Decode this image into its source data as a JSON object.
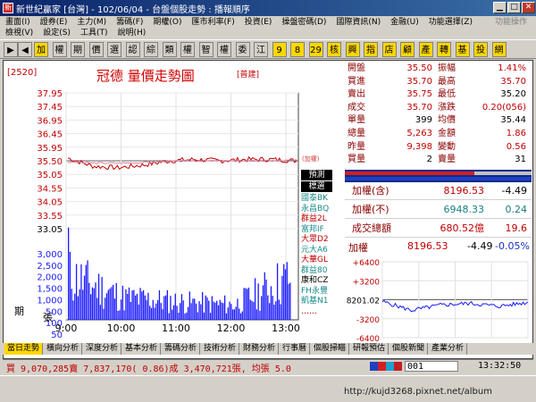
{
  "window": {
    "title": "新世紀贏家 [台灣] - 102/06/04 - 台盤個股走勢 : 播報順序",
    "icon": "app-icon"
  },
  "menu1": {
    "items": [
      "畫面(I)",
      "證券(E)",
      "主力(M)",
      "籌碼(F)",
      "期權(O)",
      "匯市利率(F)",
      "投資(E)",
      "操盤密碼(D)",
      "國際資訊(N)",
      "金融(U)",
      "功能選擇(Z)"
    ],
    "right": "功能操作"
  },
  "menu2": {
    "items": [
      "檢視(V)",
      "設定(S)",
      "工具(T)",
      "說明(H)"
    ]
  },
  "toolbar": {
    "buttons": [
      "加",
      "權",
      "期",
      "價",
      "選",
      "認",
      "綜",
      "類",
      "權",
      "智",
      "權",
      "委",
      "江",
      "9",
      "8",
      "29",
      "核",
      "興",
      "指",
      "店",
      "顧",
      "產",
      "轉",
      "基",
      "投",
      "網"
    ]
  },
  "chart": {
    "stock_code": "[2520]",
    "title": "冠德  量價走勢圖",
    "tag": "[普建]",
    "price_ticks": [
      "37.95",
      "37.45",
      "36.95",
      "36.45",
      "35.95",
      "35.50",
      "35.05",
      "34.55",
      "34.05",
      "33.55",
      "33.05"
    ],
    "volume_ticks": [
      "3,000",
      "2,500",
      "2,000",
      "1,500",
      "1,000",
      "500",
      "100",
      "50",
      "15"
    ],
    "volume_label": "張",
    "period_label": "期",
    "time_ticks": [
      "9:00",
      "10:00",
      "11:00",
      "12:00",
      "13:00"
    ],
    "avg_tag": "(加權)",
    "predict_btn": "預測",
    "bench_btn": "標選",
    "brokers": [
      {
        "name": "國泰BK",
        "color": "#1b8a8a"
      },
      {
        "name": "永昌BQ",
        "color": "#1b8a8a"
      },
      {
        "name": "群益2L",
        "color": "#c00000"
      },
      {
        "name": "富邦IF",
        "color": "#1b8a8a"
      },
      {
        "name": "大眾D2",
        "color": "#c00000"
      },
      {
        "name": "元大A6",
        "color": "#1b8a8a"
      },
      {
        "name": "大華GL",
        "color": "#c00000"
      },
      {
        "name": "群益80",
        "color": "#1b8a8a"
      },
      {
        "name": "康和CZ",
        "color": "#000000"
      },
      {
        "name": "FH永豐",
        "color": "#1b8a8a"
      },
      {
        "name": "凱基N1",
        "color": "#1b8a8a"
      },
      {
        "name": "……",
        "color": "#c00000"
      }
    ]
  },
  "chart_data": [
    {
      "type": "line",
      "title": "冠德 量價走勢圖",
      "ylim": [
        33.05,
        37.95
      ],
      "x": [
        "9:00",
        "9:30",
        "10:00",
        "10:30",
        "11:00",
        "11:30",
        "12:00",
        "12:30",
        "13:00",
        "13:30"
      ],
      "series": [
        {
          "name": "",
          "values": [
            35.6,
            35.3,
            35.25,
            35.35,
            35.5,
            35.55,
            35.5,
            35.55,
            35.55,
            35.5
          ]
        },
        {
          "name": "(加權)",
          "values": [
            35.45,
            35.42,
            35.42,
            35.44,
            35.48,
            35.5,
            35.5,
            35.5,
            35.5,
            35.52
          ]
        }
      ]
    },
    {
      "type": "bar",
      "ylim": [
        0,
        3000
      ],
      "categories": [
        "9:00",
        "10:00",
        "11:00",
        "12:00",
        "13:00"
      ],
      "values": [
        1500,
        750,
        600,
        500,
        1450
      ]
    },
    {
      "type": "line",
      "title": "加權",
      "ylim": [
        -6400,
        6400
      ],
      "x": [
        "9:00",
        "10:00",
        "11:00",
        "12:00",
        "13:00",
        "13:30"
      ],
      "series": [
        {
          "name": "",
          "values": [
            -300,
            -1800,
            -900,
            -600,
            -1100,
            -450
          ]
        }
      ]
    }
  ],
  "quote": {
    "rows": [
      {
        "l1": "開盤",
        "v1": "35.50",
        "c1": "#c00000",
        "l2": "振幅",
        "v2": "1.41%",
        "c2": "#c00000"
      },
      {
        "l1": "買進",
        "v1": "35.70",
        "c1": "#c00000",
        "l2": "最高",
        "v2": "35.70",
        "c2": "#c00000"
      },
      {
        "l1": "賣出",
        "v1": "35.75",
        "c1": "#c00000",
        "l2": "最低",
        "v2": "35.20",
        "c2": "#000000"
      },
      {
        "l1": "成交",
        "v1": "35.70",
        "c1": "#c00000",
        "l2": "漲跌",
        "v2": "0.20(056)",
        "c2": "#c00000"
      },
      {
        "l1": "單量",
        "v1": "399",
        "c1": "#000000",
        "l2": "均價",
        "v2": "35.44",
        "c2": "#000000"
      },
      {
        "l1": "總量",
        "v1": "5,263",
        "c1": "#c00000",
        "l2": "金額",
        "v2": "1.86",
        "c2": "#c00000"
      },
      {
        "l1": "昨量",
        "v1": "9,398",
        "c1": "#c00000",
        "l2": "變動",
        "v2": "0.56",
        "c2": "#c00000"
      },
      {
        "l1": "買量",
        "v1": "2",
        "c1": "#000000",
        "l2": "賣量",
        "v2": "31",
        "c2": "#000000"
      }
    ]
  },
  "index": {
    "rows": [
      {
        "label": "加權(含)",
        "value": "8196.53",
        "change": "-4.49",
        "vcolor": "#c00000",
        "ccolor": "#000000"
      },
      {
        "label": "加權(不)",
        "value": "6948.33",
        "change": "0.24",
        "vcolor": "#1b7f7f",
        "ccolor": "#1b7f7f"
      },
      {
        "label": "成交總額",
        "value": "680.52億",
        "change": "19.6",
        "vcolor": "#c00000",
        "ccolor": "#c00000"
      }
    ]
  },
  "taiex": {
    "label": "加權",
    "value": "8196.53",
    "change": "-4.49",
    "pct": "-0.05%",
    "ticks": [
      "+6400",
      "+3200",
      "8201.02",
      "-3200",
      "-6400"
    ]
  },
  "tabs": [
    "當日走勢",
    "橫向分析",
    "深度分析",
    "基本分析",
    "籌碼分析",
    "技術分析",
    "財務分析",
    "行事曆",
    "個股掃瞄",
    "研報預估",
    "個股新聞",
    "產業分析"
  ],
  "status": {
    "text": "買 9,070,285賣 7,837,170( 0.86)成 3,470,721張, 均張 5.0",
    "code": "001",
    "time": "13:32:50"
  },
  "watermark": "http://kujd3268.pixnet.net/album",
  "colors": {
    "up": "#c00000",
    "flat": "#1b8a8a",
    "volume": "#1a1aff",
    "avg": "#d04040",
    "title_bar": "#0a246a"
  }
}
